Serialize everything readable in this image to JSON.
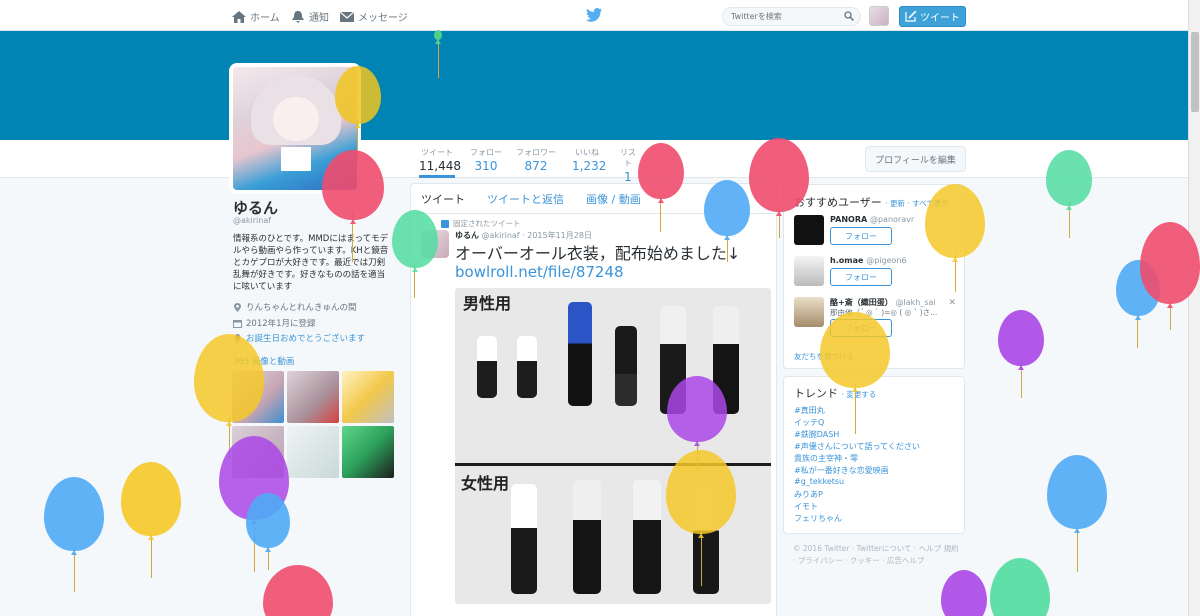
{
  "nav": {
    "home": "ホーム",
    "notifications": "通知",
    "messages": "メッセージ",
    "search_placeholder": "Twitterを検索",
    "tweet_button": "ツイート"
  },
  "colors": {
    "banner": "#0084b4",
    "accent": "#3b94d9"
  },
  "stats": [
    {
      "label": "ツイート",
      "value": "11,448"
    },
    {
      "label": "フォロー",
      "value": "310"
    },
    {
      "label": "フォロワー",
      "value": "872"
    },
    {
      "label": "いいね",
      "value": "1,232"
    },
    {
      "label": "リスト",
      "value": "1"
    }
  ],
  "edit_profile": "プロフィールを編集",
  "profile": {
    "name": "ゆるん",
    "handle": "@akirinaf",
    "bio": "情報系のひとです。MMDにはまってモデルやら動画やら作っています。KHと鏡音とカゲプロが大好きです。最近では刀剣乱舞が好きです。好きなものの話を適当に呟いています",
    "location": "りんちゃんとれんきゅんの間",
    "joined": "2012年1月に登録",
    "birthday": "お誕生日おめでとうございます",
    "media": "365 画像と動画"
  },
  "timeline": {
    "tabs": [
      "ツイート",
      "ツイートと返信",
      "画像 / 動画"
    ],
    "pinned_label": "固定されたツイート",
    "tweet": {
      "name": "ゆるん",
      "meta": "@akirinaf · 2015年11月28日",
      "text": "オーバーオール衣装，配布始めました↓",
      "link": "bowlroll.net/file/87248",
      "image_label_male": "男性用",
      "image_label_female": "女性用"
    }
  },
  "who_to_follow": {
    "title": "おすすめユーザー",
    "refresh": "· 更新 · すべて表示",
    "users": [
      {
        "name": "PANORA",
        "handle": "@panoravr"
      },
      {
        "name": "h.omae",
        "handle": "@pigeon6"
      },
      {
        "name": "酪+斎（織田蛋）",
        "handle": "@lakh_sai",
        "extra": "那由他（´ ◎ ` )=◎ ( ◎ ` )さ..."
      }
    ],
    "follow_label": "フォロー",
    "find_friends": "友だちを見つける"
  },
  "trends": {
    "title": "トレンド",
    "change": "· 変更する",
    "items": [
      "#真田丸",
      "イッテQ",
      "#鉄腕DASH",
      "#声優さんについて語ってください",
      "貴族の主宰神・零",
      "#私が一番好きな恋愛映画",
      "#g_tekketsu",
      "みりあP",
      "イモト",
      "フェリちゃん"
    ]
  },
  "footer": "© 2016 Twitter · Twitterについて · ヘルプ 規約 · プライバシー · クッキー · 広告ヘルプ"
}
